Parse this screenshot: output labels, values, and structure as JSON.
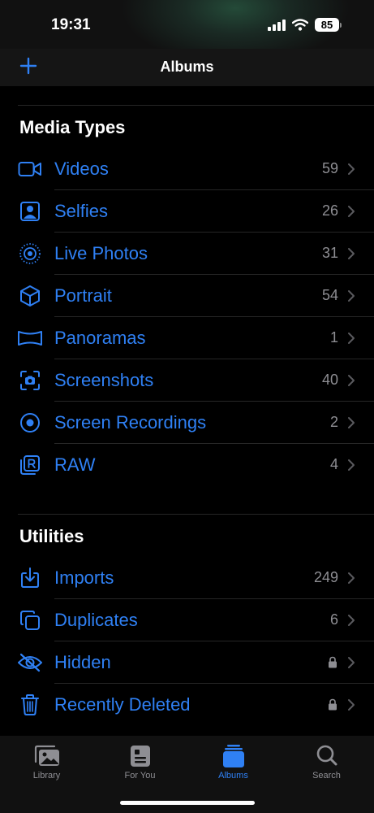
{
  "status_bar": {
    "time": "19:31",
    "battery": "85"
  },
  "nav": {
    "title": "Albums",
    "add_icon": "plus-icon"
  },
  "media_types": {
    "title": "Media Types",
    "items": [
      {
        "label": "Videos",
        "count": "59",
        "icon": "video-icon"
      },
      {
        "label": "Selfies",
        "count": "26",
        "icon": "selfie-icon"
      },
      {
        "label": "Live Photos",
        "count": "31",
        "icon": "live-photo-icon"
      },
      {
        "label": "Portrait",
        "count": "54",
        "icon": "cube-icon"
      },
      {
        "label": "Panoramas",
        "count": "1",
        "icon": "panorama-icon"
      },
      {
        "label": "Screenshots",
        "count": "40",
        "icon": "screenshot-icon"
      },
      {
        "label": "Screen Recordings",
        "count": "2",
        "icon": "screen-recording-icon"
      },
      {
        "label": "RAW",
        "count": "4",
        "icon": "raw-icon"
      }
    ]
  },
  "utilities": {
    "title": "Utilities",
    "items": [
      {
        "label": "Imports",
        "count": "249",
        "icon": "import-icon"
      },
      {
        "label": "Duplicates",
        "count": "6",
        "icon": "duplicates-icon"
      },
      {
        "label": "Hidden",
        "icon": "eye-slash-icon",
        "locked": true
      },
      {
        "label": "Recently Deleted",
        "icon": "trash-icon",
        "locked": true
      }
    ]
  },
  "tab_bar": {
    "tabs": [
      {
        "label": "Library",
        "icon": "photo-library-icon"
      },
      {
        "label": "For You",
        "icon": "for-you-icon"
      },
      {
        "label": "Albums",
        "icon": "albums-icon",
        "active": true
      },
      {
        "label": "Search",
        "icon": "search-icon"
      }
    ]
  },
  "colors": {
    "accent": "#2f80f4",
    "secondary_text": "#8e8e93",
    "background": "#000000"
  }
}
